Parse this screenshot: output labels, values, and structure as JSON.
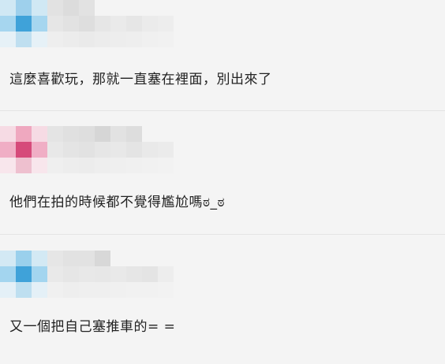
{
  "colors": {
    "background": "#f4f4f4",
    "text": "#222222",
    "divider": "#e4e4e4"
  },
  "comments": [
    {
      "avatar_icon": "user-avatar-blurred-blue",
      "avatar_colors": [
        "#d0e8f4",
        "#9ed0ec",
        "#d0e8f4",
        "#a6d6ef",
        "#3fa2d9",
        "#a6d6ef",
        "#e6f1f7",
        "#bfdff0",
        "#e6f1f7"
      ],
      "text": "這麼喜歡玩，那就一直塞在裡面，別出來了"
    },
    {
      "avatar_icon": "user-avatar-blurred-pink",
      "avatar_colors": [
        "#f6dbe4",
        "#efa8bf",
        "#f6dbe4",
        "#f0aec5",
        "#d64a7a",
        "#f0aec5",
        "#f8e6ec",
        "#eec0cf",
        "#f8e6ec"
      ],
      "text": "他們在拍的時候都不覺得尷尬嗎ಠ_ಠ"
    },
    {
      "avatar_icon": "user-avatar-blurred-blue",
      "avatar_colors": [
        "#d3e9f4",
        "#9ad0ec",
        "#d3e9f4",
        "#a3d5ef",
        "#3fa2d9",
        "#a3d5ef",
        "#e4f0f7",
        "#bedff0",
        "#e4f0f7"
      ],
      "text": "又一個把自己塞推車的= ="
    }
  ]
}
